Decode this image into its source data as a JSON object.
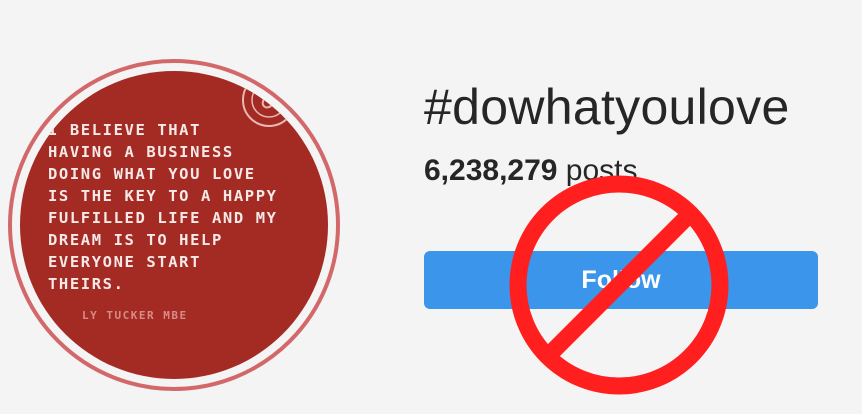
{
  "profile": {
    "quote_lines": "I BELIEVE THAT\nHAVING A BUSINESS\nDOING WHAT YOU LOVE\nIS THE KEY TO A HAPPY\nFULFILLED LIFE AND MY\nDREAM IS TO HELP\nEVERYONE START\nTHEIRS.",
    "author": "LY TUCKER MBE",
    "image_bg_color": "#a32b24",
    "ring_color": "#d3686a",
    "seal_icon": "stamp-icon"
  },
  "hashtag": {
    "title": "#dowhatyoulove",
    "post_count": "6,238,279",
    "post_label": " posts"
  },
  "actions": {
    "follow_label": "Follow",
    "follow_color": "#3b95ea"
  },
  "overlay": {
    "icon": "prohibited-icon",
    "color": "#ff1f1f"
  }
}
